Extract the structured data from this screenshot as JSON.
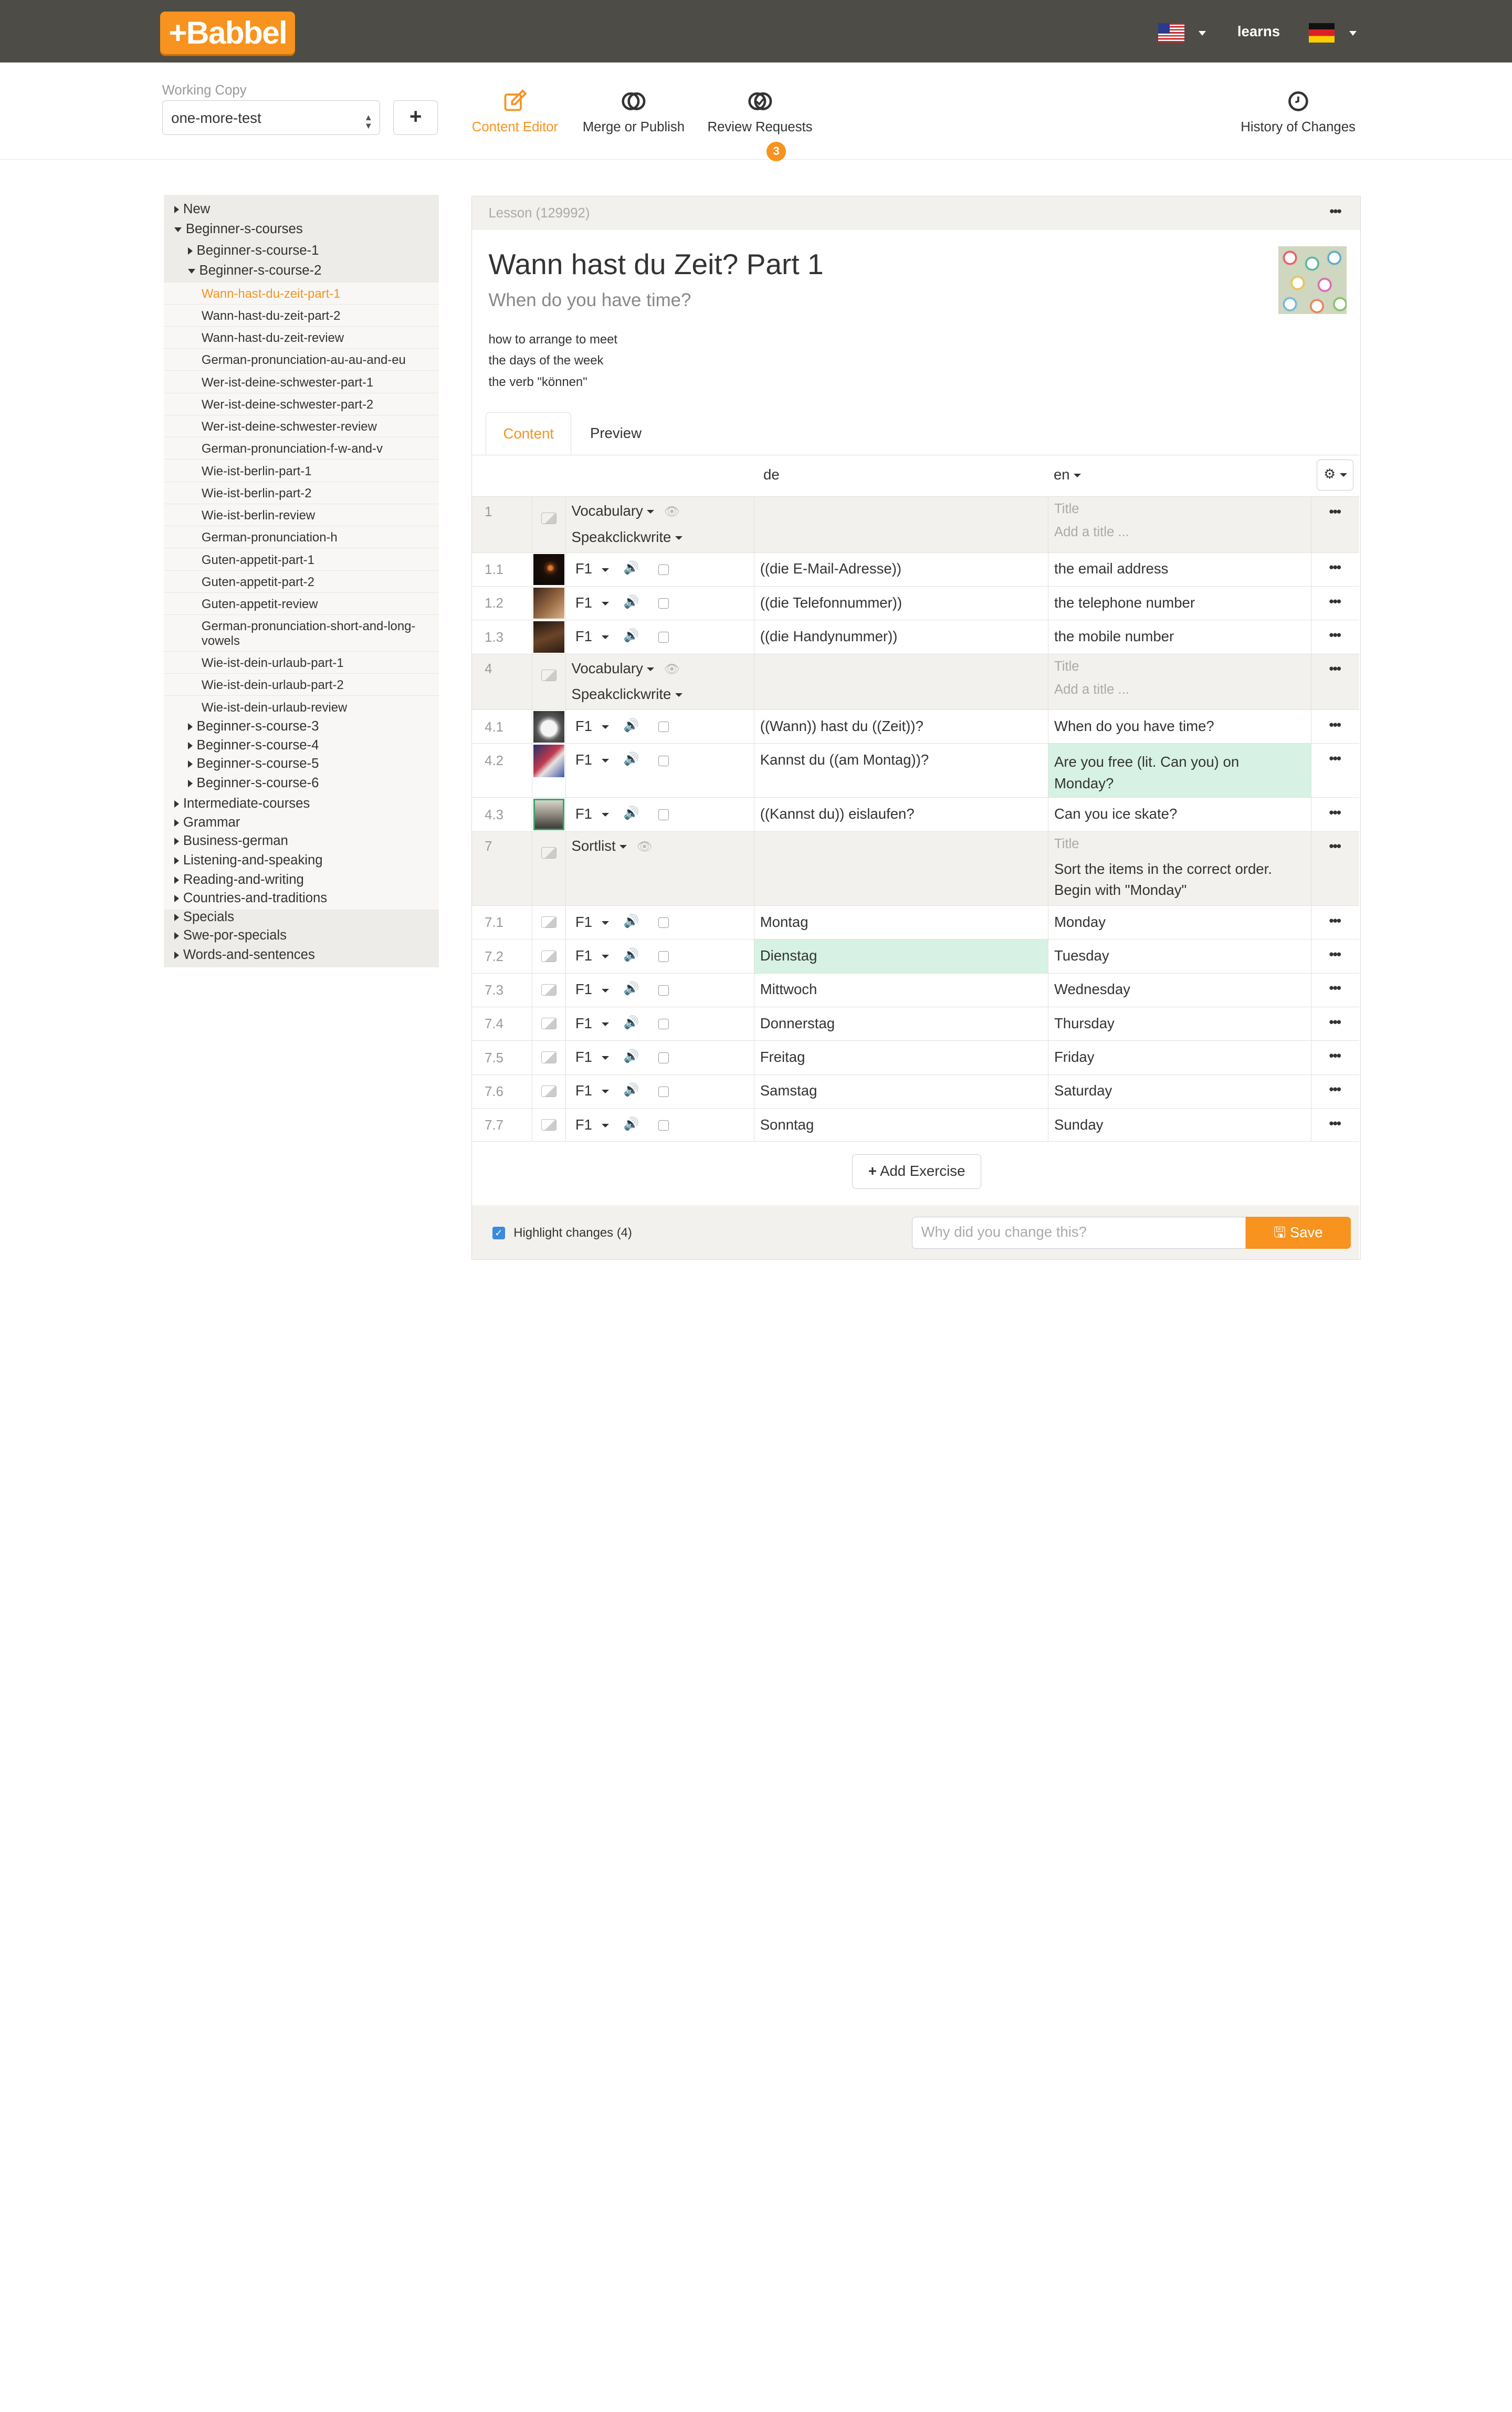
{
  "brand": {
    "logo": "+Babbel",
    "accent": "#f7931e"
  },
  "header": {
    "learns": "learns",
    "flags": [
      "us-flag",
      "de-flag"
    ]
  },
  "toolbar": {
    "working_copy_label": "Working Copy",
    "working_copy_value": "one-more-test",
    "add": "+",
    "nav": {
      "content_editor": "Content Editor",
      "merge_publish": "Merge or Publish",
      "review_requests": "Review Requests",
      "review_badge": "3",
      "history": "History of Changes"
    }
  },
  "sidebar": {
    "new": "New",
    "beginner_courses": "Beginner-s-courses",
    "course1": "Beginner-s-course-1",
    "course2": "Beginner-s-course-2",
    "lessons": [
      "Wann-hast-du-zeit-part-1",
      "Wann-hast-du-zeit-part-2",
      "Wann-hast-du-zeit-review",
      "German-pronunciation-au-au-and-eu",
      "Wer-ist-deine-schwester-part-1",
      "Wer-ist-deine-schwester-part-2",
      "Wer-ist-deine-schwester-review",
      "German-pronunciation-f-w-and-v",
      "Wie-ist-berlin-part-1",
      "Wie-ist-berlin-part-2",
      "Wie-ist-berlin-review",
      "German-pronunciation-h",
      "Guten-appetit-part-1",
      "Guten-appetit-part-2",
      "Guten-appetit-review",
      "German-pronunciation-short-and-long-vowels",
      "Wie-ist-dein-urlaub-part-1",
      "Wie-ist-dein-urlaub-part-2",
      "Wie-ist-dein-urlaub-review"
    ],
    "more_courses": [
      "Beginner-s-course-3",
      "Beginner-s-course-4",
      "Beginner-s-course-5",
      "Beginner-s-course-6"
    ],
    "top_level": [
      "Intermediate-courses",
      "Grammar",
      "Business-german",
      "Listening-and-speaking",
      "Reading-and-writing",
      "Countries-and-traditions",
      "Specials",
      "Swe-por-specials",
      "Words-and-sentences"
    ]
  },
  "lesson": {
    "id": "Lesson (129992)",
    "title": "Wann hast du Zeit? Part 1",
    "subtitle": "When do you have time?",
    "description": [
      "how to arrange to meet",
      "the days of the week",
      "the verb \"können\""
    ],
    "tabs": {
      "content": "Content",
      "preview": "Preview"
    },
    "col_de": "de",
    "col_en": "en",
    "more": "•••"
  },
  "exercises": {
    "g1": {
      "num": "1",
      "type": "Vocabulary",
      "sub": "Speakclickwrite",
      "title_label": "Title",
      "title_value": "Add a title ..."
    },
    "g4": {
      "num": "4",
      "type": "Vocabulary",
      "sub": "Speakclickwrite",
      "title_label": "Title",
      "title_value": "Add a title ..."
    },
    "g7": {
      "num": "7",
      "type": "Sortlist",
      "title_label": "Title",
      "title_value": "Sort the items in the correct order. Begin with \"Monday\""
    },
    "items": [
      {
        "num": "1.1",
        "f": "F1",
        "de": "((die E-Mail-Adresse))",
        "en": "the email address"
      },
      {
        "num": "1.2",
        "f": "F1",
        "de": "((die Telefonnummer))",
        "en": "the telephone number"
      },
      {
        "num": "1.3",
        "f": "F1",
        "de": "((die Handynummer))",
        "en": "the mobile number"
      },
      {
        "num": "4.1",
        "f": "F1",
        "de": "((Wann)) hast du ((Zeit))?",
        "en": "When do you have time?"
      },
      {
        "num": "4.2",
        "f": "F1",
        "de": "Kannst du ((am Montag))?",
        "en": "Are you free (lit. Can you) on Monday?"
      },
      {
        "num": "4.3",
        "f": "F1",
        "de": "((Kannst du)) eislaufen?",
        "en": "Can you ice skate?"
      },
      {
        "num": "7.1",
        "f": "F1",
        "de": "Montag",
        "en": "Monday"
      },
      {
        "num": "7.2",
        "f": "F1",
        "de": "Dienstag",
        "en": "Tuesday"
      },
      {
        "num": "7.3",
        "f": "F1",
        "de": "Mittwoch",
        "en": "Wednesday"
      },
      {
        "num": "7.4",
        "f": "F1",
        "de": "Donnerstag",
        "en": "Thursday"
      },
      {
        "num": "7.5",
        "f": "F1",
        "de": "Freitag",
        "en": "Friday"
      },
      {
        "num": "7.6",
        "f": "F1",
        "de": "Samstag",
        "en": "Saturday"
      },
      {
        "num": "7.7",
        "f": "F1",
        "de": "Sonntag",
        "en": "Sunday"
      }
    ]
  },
  "footer": {
    "add_exercise": "Add Exercise",
    "highlight": "Highlight changes (4)",
    "why_placeholder": "Why did you change this?",
    "save": "Save"
  }
}
